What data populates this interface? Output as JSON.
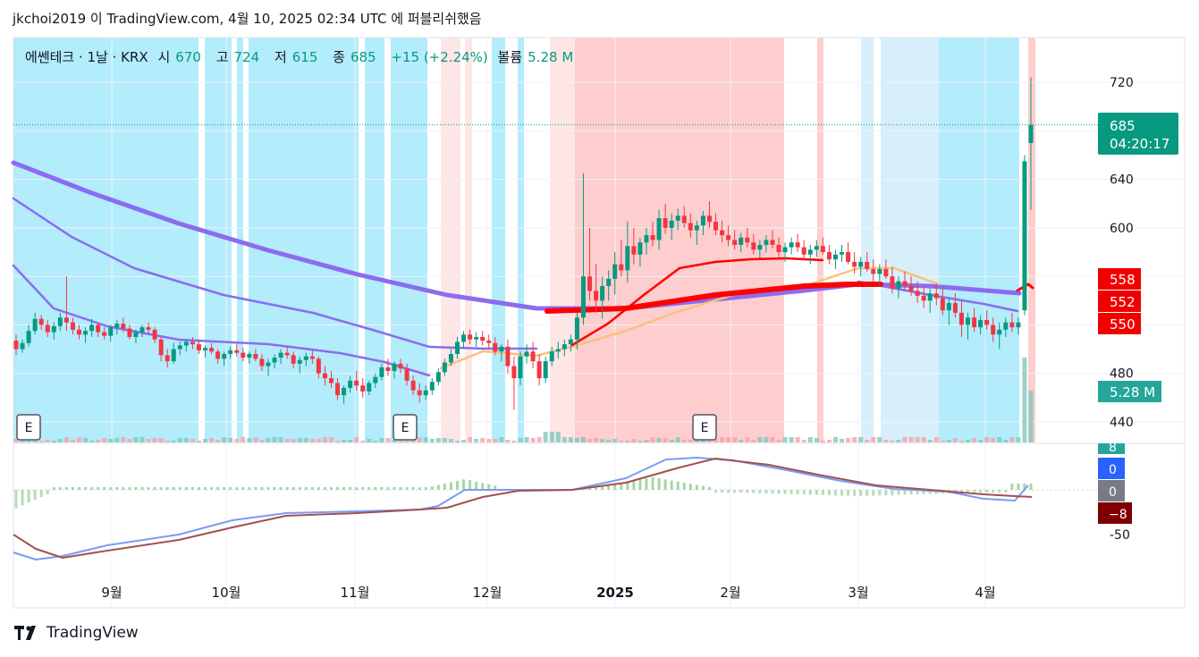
{
  "header": {
    "publish_line": "jkchoi2019 이 TradingView.com, 4월 10, 2025 02:34 UTC 에 퍼블리쉬했음"
  },
  "legend": {
    "symbol": "에쎈테크 · 1날 · KRX",
    "open_label": "시",
    "open_value": "670",
    "high_label": "고",
    "high_value": "724",
    "low_label": "저",
    "low_value": "615",
    "close_label": "종",
    "close_value": "685",
    "change": "+15 (+2.24%)",
    "volume_label": "볼륨",
    "volume_value": "5.28 M"
  },
  "footer": {
    "brand": "TradingView"
  },
  "colors": {
    "up": "#089981",
    "down": "#f23645",
    "bg_blue": "#b3ecfb",
    "bg_light_blue": "#d7effb",
    "bg_pink": "#fecdcd",
    "bg_light_pink": "#fee6e6",
    "ma_purple": "#8b6cf0",
    "ma_orange": "#f9c17a",
    "ma_red": "#ff0000",
    "macd_line": "#7b9cf5",
    "signal_line": "#a0524f",
    "hist_pos": "#a5d6a7",
    "hist_neg": "#b5dcb7"
  },
  "chart_data": [
    {
      "type": "candlestick",
      "title": "에쎈테크 · 1날 · KRX",
      "x_labels": [
        "9월",
        "10월",
        "11월",
        "12월",
        "2025",
        "2월",
        "3월",
        "4월"
      ],
      "y_ticks": [
        440,
        480,
        600,
        640,
        720
      ],
      "ylim": [
        423,
        757
      ],
      "last_price": {
        "value": 685,
        "label": "685",
        "countdown": "04:20:17"
      },
      "price_tags": [
        {
          "label": "558",
          "value": 558
        },
        {
          "label": "552",
          "value": 552
        },
        {
          "label": "550",
          "value": 550
        }
      ],
      "volume_tag": "5.28 M",
      "earnings_markers": [
        "E",
        "E",
        "E"
      ],
      "candles": [
        [
          507,
          512,
          495,
          500
        ],
        [
          500,
          508,
          497,
          505
        ],
        [
          505,
          520,
          502,
          515
        ],
        [
          515,
          530,
          512,
          525
        ],
        [
          525,
          528,
          516,
          520
        ],
        [
          520,
          524,
          510,
          514
        ],
        [
          514,
          522,
          508,
          519
        ],
        [
          519,
          530,
          515,
          526
        ],
        [
          526,
          560,
          515,
          522
        ],
        [
          522,
          526,
          512,
          516
        ],
        [
          516,
          520,
          508,
          512
        ],
        [
          512,
          518,
          505,
          515
        ],
        [
          515,
          525,
          510,
          520
        ],
        [
          520,
          522,
          510,
          514
        ],
        [
          514,
          518,
          508,
          511
        ],
        [
          511,
          520,
          506,
          518
        ],
        [
          518,
          524,
          512,
          521
        ],
        [
          521,
          526,
          514,
          517
        ],
        [
          517,
          520,
          508,
          510
        ],
        [
          510,
          516,
          505,
          514
        ],
        [
          514,
          520,
          510,
          518
        ],
        [
          518,
          522,
          512,
          516
        ],
        [
          516,
          518,
          505,
          508
        ],
        [
          508,
          510,
          490,
          495
        ],
        [
          495,
          500,
          485,
          490
        ],
        [
          490,
          505,
          488,
          500
        ],
        [
          500,
          506,
          495,
          503
        ],
        [
          503,
          508,
          498,
          506
        ],
        [
          506,
          510,
          500,
          504
        ],
        [
          504,
          508,
          496,
          499
        ],
        [
          499,
          503,
          493,
          501
        ],
        [
          501,
          505,
          496,
          498
        ],
        [
          498,
          500,
          488,
          492
        ],
        [
          492,
          498,
          486,
          496
        ],
        [
          496,
          502,
          492,
          499
        ],
        [
          499,
          504,
          494,
          497
        ],
        [
          497,
          501,
          490,
          493
        ],
        [
          493,
          498,
          488,
          496
        ],
        [
          496,
          500,
          490,
          492
        ],
        [
          492,
          496,
          482,
          486
        ],
        [
          486,
          492,
          478,
          489
        ],
        [
          489,
          496,
          484,
          493
        ],
        [
          493,
          500,
          488,
          497
        ],
        [
          497,
          503,
          492,
          495
        ],
        [
          495,
          498,
          484,
          488
        ],
        [
          488,
          494,
          480,
          491
        ],
        [
          491,
          497,
          486,
          494
        ],
        [
          494,
          499,
          488,
          492
        ],
        [
          492,
          494,
          476,
          480
        ],
        [
          480,
          486,
          470,
          476
        ],
        [
          476,
          482,
          468,
          472
        ],
        [
          472,
          476,
          458,
          462
        ],
        [
          462,
          470,
          455,
          468
        ],
        [
          468,
          478,
          464,
          474
        ],
        [
          474,
          482,
          466,
          470
        ],
        [
          470,
          476,
          460,
          465
        ],
        [
          465,
          474,
          462,
          472
        ],
        [
          472,
          480,
          468,
          477
        ],
        [
          477,
          488,
          474,
          485
        ],
        [
          485,
          492,
          478,
          482
        ],
        [
          482,
          490,
          476,
          488
        ],
        [
          488,
          492,
          480,
          484
        ],
        [
          484,
          488,
          470,
          474
        ],
        [
          474,
          478,
          462,
          466
        ],
        [
          466,
          472,
          456,
          462
        ],
        [
          462,
          470,
          458,
          466
        ],
        [
          466,
          476,
          462,
          473
        ],
        [
          473,
          484,
          470,
          481
        ],
        [
          481,
          492,
          478,
          489
        ],
        [
          489,
          500,
          486,
          496
        ],
        [
          496,
          510,
          492,
          506
        ],
        [
          506,
          515,
          500,
          512
        ],
        [
          512,
          516,
          504,
          508
        ],
        [
          508,
          514,
          502,
          510
        ],
        [
          510,
          515,
          503,
          507
        ],
        [
          507,
          512,
          500,
          505
        ],
        [
          505,
          510,
          495,
          498
        ],
        [
          498,
          504,
          490,
          502
        ],
        [
          502,
          508,
          480,
          486
        ],
        [
          486,
          494,
          450,
          476
        ],
        [
          476,
          498,
          470,
          494
        ],
        [
          494,
          504,
          488,
          498
        ],
        [
          498,
          506,
          484,
          490
        ],
        [
          490,
          496,
          470,
          476
        ],
        [
          476,
          494,
          472,
          490
        ],
        [
          490,
          502,
          486,
          498
        ],
        [
          498,
          506,
          492,
          500
        ],
        [
          500,
          508,
          494,
          504
        ],
        [
          504,
          512,
          498,
          508
        ],
        [
          508,
          530,
          500,
          526
        ],
        [
          526,
          645,
          520,
          560
        ],
        [
          560,
          600,
          540,
          548
        ],
        [
          548,
          570,
          530,
          540
        ],
        [
          540,
          560,
          525,
          552
        ],
        [
          552,
          565,
          540,
          558
        ],
        [
          558,
          580,
          545,
          570
        ],
        [
          570,
          590,
          560,
          565
        ],
        [
          565,
          605,
          555,
          585
        ],
        [
          585,
          600,
          570,
          578
        ],
        [
          578,
          592,
          568,
          588
        ],
        [
          588,
          600,
          578,
          594
        ],
        [
          594,
          605,
          585,
          590
        ],
        [
          590,
          615,
          582,
          608
        ],
        [
          608,
          620,
          595,
          600
        ],
        [
          600,
          612,
          590,
          606
        ],
        [
          606,
          616,
          598,
          610
        ],
        [
          610,
          618,
          600,
          604
        ],
        [
          604,
          612,
          592,
          598
        ],
        [
          598,
          606,
          586,
          602
        ],
        [
          602,
          614,
          594,
          610
        ],
        [
          610,
          622,
          600,
          605
        ],
        [
          605,
          612,
          594,
          598
        ],
        [
          598,
          606,
          588,
          594
        ],
        [
          594,
          602,
          585,
          590
        ],
        [
          590,
          598,
          582,
          586
        ],
        [
          586,
          596,
          580,
          592
        ],
        [
          592,
          600,
          584,
          588
        ],
        [
          588,
          595,
          578,
          582
        ],
        [
          582,
          590,
          575,
          586
        ],
        [
          586,
          594,
          580,
          590
        ],
        [
          590,
          598,
          583,
          586
        ],
        [
          586,
          592,
          576,
          580
        ],
        [
          580,
          588,
          572,
          584
        ],
        [
          584,
          592,
          578,
          588
        ],
        [
          588,
          595,
          580,
          584
        ],
        [
          584,
          590,
          574,
          578
        ],
        [
          578,
          586,
          570,
          582
        ],
        [
          582,
          590,
          576,
          585
        ],
        [
          585,
          592,
          578,
          580
        ],
        [
          580,
          586,
          570,
          574
        ],
        [
          574,
          582,
          566,
          578
        ],
        [
          578,
          586,
          572,
          580
        ],
        [
          580,
          588,
          570,
          572
        ],
        [
          572,
          580,
          562,
          568
        ],
        [
          568,
          576,
          560,
          572
        ],
        [
          572,
          580,
          564,
          566
        ],
        [
          566,
          574,
          556,
          562
        ],
        [
          562,
          570,
          552,
          566
        ],
        [
          566,
          574,
          558,
          560
        ],
        [
          560,
          568,
          546,
          550
        ],
        [
          550,
          560,
          542,
          556
        ],
        [
          556,
          564,
          548,
          552
        ],
        [
          552,
          560,
          544,
          548
        ],
        [
          548,
          556,
          538,
          544
        ],
        [
          544,
          552,
          534,
          540
        ],
        [
          540,
          550,
          530,
          546
        ],
        [
          546,
          554,
          536,
          542
        ],
        [
          542,
          550,
          528,
          532
        ],
        [
          532,
          542,
          520,
          538
        ],
        [
          538,
          546,
          526,
          530
        ],
        [
          530,
          540,
          510,
          520
        ],
        [
          520,
          530,
          508,
          526
        ],
        [
          526,
          534,
          514,
          518
        ],
        [
          518,
          528,
          512,
          524
        ],
        [
          524,
          532,
          516,
          520
        ],
        [
          520,
          526,
          506,
          512
        ],
        [
          512,
          522,
          500,
          516
        ],
        [
          516,
          526,
          510,
          522
        ],
        [
          522,
          530,
          514,
          518
        ],
        [
          518,
          526,
          512,
          522
        ],
        [
          532,
          660,
          528,
          655
        ],
        [
          670,
          724,
          615,
          685
        ]
      ],
      "macd": {
        "y_ticks": [
          -50
        ],
        "tags": [
          {
            "label": "8",
            "value": 8
          },
          {
            "label": "0",
            "value": 0
          },
          {
            "label": "0",
            "value": 0
          },
          {
            "label": "−8",
            "value": -8
          }
        ]
      }
    }
  ]
}
